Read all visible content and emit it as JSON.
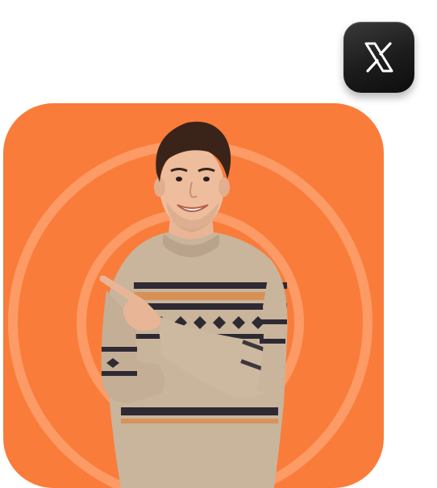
{
  "brand": {
    "accent_color": "#FA7C3A",
    "ring_color": "#FFB48A",
    "badge_icon": "x-logo-icon"
  },
  "illustration": {
    "subject": "person-icon",
    "sweater_color": "#C9B49C",
    "pattern_dark": "#2E2A33",
    "pattern_orange": "#D98B4A"
  }
}
